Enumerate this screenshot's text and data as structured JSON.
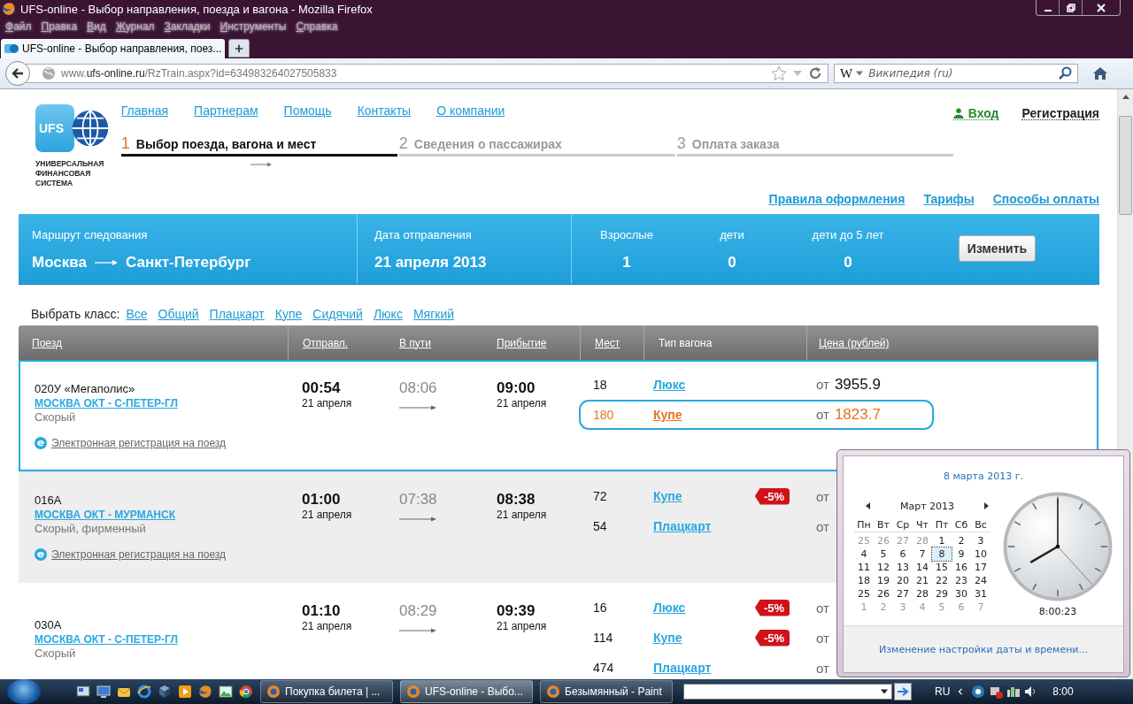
{
  "browser": {
    "title": "UFS-online - Выбор направления, поезда и вагона - Mozilla Firefox",
    "menu": [
      "Файл",
      "Правка",
      "Вид",
      "Журнал",
      "Закладки",
      "Инструменты",
      "Справка"
    ],
    "tabs": [
      {
        "title": "UFS-online - Выбор направления, поез...",
        "selected": true
      }
    ],
    "address": {
      "prefix": "www.",
      "domain": "ufs-online.ru",
      "path": "/RzTrain.aspx?id=634983264027505833"
    },
    "search": {
      "engine_mark": "W",
      "placeholder": "Википедия (ru)"
    }
  },
  "site": {
    "logo": {
      "mark": "UFS",
      "caption": "УНИВЕРСАЛЬНАЯ ФИНАНСОВАЯ СИСТЕМА"
    },
    "nav": [
      "Главная",
      "Партнерам",
      "Помощь",
      "Контакты",
      "О компании"
    ],
    "account": {
      "login": "Вход",
      "register": "Регистрация"
    },
    "steps": [
      {
        "number": "1",
        "label": "Выбор поезда, вагона и мест",
        "selected": true
      },
      {
        "number": "2",
        "label": "Сведения о пассажирах",
        "selected": false
      },
      {
        "number": "3",
        "label": "Оплата заказа",
        "selected": false
      }
    ],
    "info_links": [
      "Правила оформления",
      "Тарифы",
      "Способы оплаты"
    ],
    "search_summary": {
      "route_label": "Маршрут следования",
      "from": "Москва",
      "to": "Санкт-Петербург",
      "date_label": "Дата отправления",
      "date": "21 апреля 2013",
      "passengers": [
        {
          "label": "Взрослые",
          "count": "1"
        },
        {
          "label": "дети",
          "count": "0"
        },
        {
          "label": "дети до 5 лет",
          "count": "0"
        }
      ],
      "button": "Изменить"
    },
    "class_filter": {
      "label": "Выбрать класс:",
      "options": [
        "Все",
        "Общий",
        "Плацкарт",
        "Купе",
        "Сидячий",
        "Люкс",
        "Мягкий"
      ]
    },
    "table": {
      "columns": [
        {
          "label": "Поезд",
          "sortable": true
        },
        {
          "label": "Отправл.",
          "sortable": true
        },
        {
          "label": "В пути",
          "sortable": true
        },
        {
          "label": "Прибытие",
          "sortable": true
        },
        {
          "label": "Мест",
          "sortable": true
        },
        {
          "label": "Тип вагона",
          "sortable": false
        },
        {
          "label": "Цена (рублей)",
          "sortable": true
        }
      ],
      "rows": [
        {
          "number": "020У «Мегаполис»",
          "route": "МОСКВА ОКТ - С-ПЕТЕР-ГЛ",
          "category": "Скорый",
          "e_registration": "Электронная регистрация на поезд",
          "departure_time": "00:54",
          "departure_date": "21 апреля",
          "duration": "08:06",
          "arrival_time": "09:00",
          "arrival_date": "21 апреля",
          "selected": true,
          "cars": [
            {
              "seats": "18",
              "type": "Люкс",
              "price_prefix": "от",
              "price": "3955.9",
              "selected": false
            },
            {
              "seats": "180",
              "type": "Купе",
              "price_prefix": "от",
              "price": "1823.7",
              "selected": true
            }
          ]
        },
        {
          "number": "016А",
          "route": "МОСКВА ОКТ - МУРМАНСК",
          "category": "Скорый, фирменный",
          "e_registration": "Электронная регистрация на поезд",
          "departure_time": "01:00",
          "departure_date": "21 апреля",
          "duration": "07:38",
          "arrival_time": "08:38",
          "arrival_date": "21 апреля",
          "selected": false,
          "cars": [
            {
              "seats": "72",
              "type": "Купе",
              "discount": "-5%",
              "price_prefix": "от",
              "selected": false
            },
            {
              "seats": "54",
              "type": "Плацкарт",
              "price_prefix": "от",
              "selected": false
            }
          ]
        },
        {
          "number": "030А",
          "route": "МОСКВА ОКТ - С-ПЕТЕР-ГЛ",
          "category": "Скорый",
          "departure_time": "01:10",
          "departure_date": "21 апреля",
          "duration": "08:29",
          "arrival_time": "09:39",
          "arrival_date": "21 апреля",
          "selected": false,
          "cars": [
            {
              "seats": "16",
              "type": "Люкс",
              "discount": "-5%",
              "price_prefix": "от",
              "selected": false
            },
            {
              "seats": "114",
              "type": "Купе",
              "discount": "-5%",
              "price_prefix": "от",
              "selected": false
            },
            {
              "seats": "474",
              "type": "Плацкарт",
              "price_prefix": "от",
              "selected": false
            }
          ]
        }
      ]
    }
  },
  "clock_popup": {
    "date": "8 марта 2013 г.",
    "month": "Март 2013",
    "weekdays": [
      "Пн",
      "Вт",
      "Ср",
      "Чт",
      "Пт",
      "Сб",
      "Вс"
    ],
    "weeks": [
      [
        {
          "label": "25",
          "muted": true,
          "selected": false
        },
        {
          "label": "26",
          "muted": true,
          "selected": false
        },
        {
          "label": "27",
          "muted": true,
          "selected": false
        },
        {
          "label": "28",
          "muted": true,
          "selected": false
        },
        {
          "label": "1",
          "muted": false,
          "selected": false
        },
        {
          "label": "2",
          "muted": false,
          "selected": false
        },
        {
          "label": "3",
          "muted": false,
          "selected": false
        }
      ],
      [
        {
          "label": "4",
          "muted": false,
          "selected": false
        },
        {
          "label": "5",
          "muted": false,
          "selected": false
        },
        {
          "label": "6",
          "muted": false,
          "selected": false
        },
        {
          "label": "7",
          "muted": false,
          "selected": false
        },
        {
          "label": "8",
          "muted": false,
          "selected": true
        },
        {
          "label": "9",
          "muted": false,
          "selected": false
        },
        {
          "label": "10",
          "muted": false,
          "selected": false
        }
      ],
      [
        {
          "label": "11",
          "muted": false,
          "selected": false
        },
        {
          "label": "12",
          "muted": false,
          "selected": false
        },
        {
          "label": "13",
          "muted": false,
          "selected": false
        },
        {
          "label": "14",
          "muted": false,
          "selected": false
        },
        {
          "label": "15",
          "muted": false,
          "selected": false
        },
        {
          "label": "16",
          "muted": false,
          "selected": false
        },
        {
          "label": "17",
          "muted": false,
          "selected": false
        }
      ],
      [
        {
          "label": "18",
          "muted": false,
          "selected": false
        },
        {
          "label": "19",
          "muted": false,
          "selected": false
        },
        {
          "label": "20",
          "muted": false,
          "selected": false
        },
        {
          "label": "21",
          "muted": false,
          "selected": false
        },
        {
          "label": "22",
          "muted": false,
          "selected": false
        },
        {
          "label": "23",
          "muted": false,
          "selected": false
        },
        {
          "label": "24",
          "muted": false,
          "selected": false
        }
      ],
      [
        {
          "label": "25",
          "muted": false,
          "selected": false
        },
        {
          "label": "26",
          "muted": false,
          "selected": false
        },
        {
          "label": "27",
          "muted": false,
          "selected": false
        },
        {
          "label": "28",
          "muted": false,
          "selected": false
        },
        {
          "label": "29",
          "muted": false,
          "selected": false
        },
        {
          "label": "30",
          "muted": false,
          "selected": false
        },
        {
          "label": "31",
          "muted": false,
          "selected": false
        }
      ],
      [
        {
          "label": "1",
          "muted": true,
          "selected": false
        },
        {
          "label": "2",
          "muted": true,
          "selected": false
        },
        {
          "label": "3",
          "muted": true,
          "selected": false
        },
        {
          "label": "4",
          "muted": true,
          "selected": false
        },
        {
          "label": "5",
          "muted": true,
          "selected": false
        },
        {
          "label": "6",
          "muted": true,
          "selected": false
        },
        {
          "label": "7",
          "muted": true,
          "selected": false
        }
      ]
    ],
    "time": "8:00:23",
    "settings_link": "Изменение настройки даты и времени..."
  },
  "taskbar": {
    "tasks": [
      {
        "label": "Покупка билета | ...",
        "selected": false
      },
      {
        "label": "UFS-online - Выбо...",
        "selected": true
      },
      {
        "label": "Безымянный - Paint",
        "selected": false
      }
    ],
    "language": "RU",
    "time": "8:00"
  }
}
